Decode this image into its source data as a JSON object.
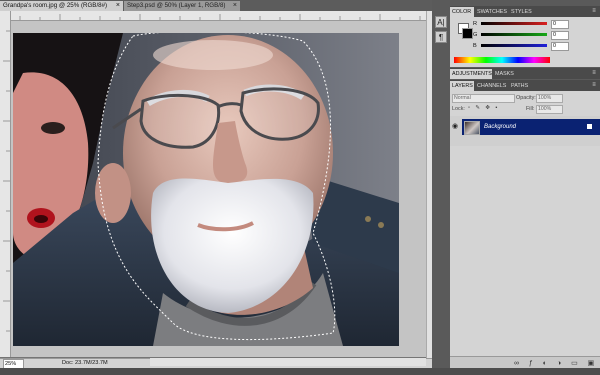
{
  "document_tabs": [
    {
      "label": "Grandpa's room.jpg @ 25% (RGB/8#)",
      "close": "×"
    },
    {
      "label": "Step3.psd @ 50% (Layer 1, RGB/8)",
      "close": "×"
    }
  ],
  "status": {
    "zoom": "25%",
    "doc_info": "Doc: 23.7M/23.7M"
  },
  "dock": {
    "icons": [
      "character-icon",
      "paragraph-icon"
    ],
    "glyphs": [
      "A|",
      "¶"
    ]
  },
  "color_panel": {
    "tabs": [
      "COLOR",
      "SWATCHES",
      "STYLES"
    ],
    "channels": [
      {
        "label": "R",
        "value": "0",
        "color": "#d92020"
      },
      {
        "label": "G",
        "value": "0",
        "color": "#18a818"
      },
      {
        "label": "B",
        "value": "0",
        "color": "#2020d9"
      }
    ],
    "foreground": "#000000",
    "background": "#ffffff"
  },
  "adjustments_panel": {
    "tabs": [
      "ADJUSTMENTS",
      "MASKS"
    ]
  },
  "layers_panel": {
    "tabs": [
      "LAYERS",
      "CHANNELS",
      "PATHS"
    ],
    "blend_mode": "Normal",
    "opacity_label": "Opacity:",
    "opacity_value": "100%",
    "lock_label": "Lock:",
    "fill_label": "Fill:",
    "fill_value": "100%",
    "layers": [
      {
        "name": "Background",
        "selected": true
      }
    ]
  },
  "colors": {
    "layer_selected": "#0a2272",
    "panel_bg": "#d4d4d4"
  }
}
